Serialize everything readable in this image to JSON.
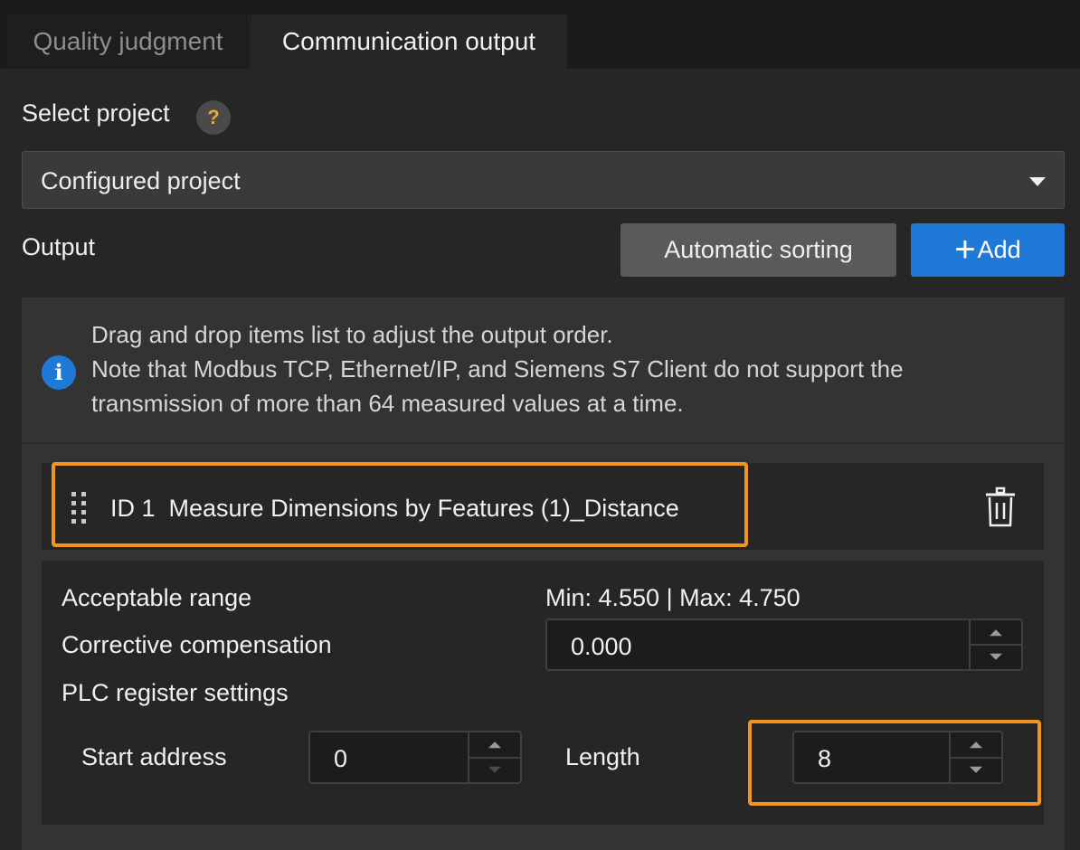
{
  "tabs": [
    {
      "label": "Quality judgment",
      "active": false
    },
    {
      "label": "Communication output",
      "active": true
    }
  ],
  "select_project": {
    "label": "Select project",
    "help_icon": "question-mark-icon",
    "selected": "Configured project"
  },
  "output": {
    "label": "Output",
    "sort_button": "Automatic sorting",
    "add_button": "Add",
    "add_icon": "plus-icon"
  },
  "info": {
    "icon": "info-icon",
    "lines": [
      "Drag and drop items list to adjust the output order.",
      "Note that Modbus TCP, Ethernet/IP, and Siemens S7 Client do not support the",
      "transmission of more than 64 measured values at a time."
    ]
  },
  "items": [
    {
      "title": "ID 1  Measure Dimensions by Features (1)_Distance",
      "drag_icon": "drag-handle-icon",
      "delete_icon": "trash-icon",
      "acceptable_range_label": "Acceptable range",
      "acceptable_range_value": "Min: 4.550 | Max: 4.750",
      "corrective_compensation_label": "Corrective compensation",
      "corrective_compensation_value": "0.000",
      "plc_label": "PLC register settings",
      "start_address_label": "Start address",
      "start_address_value": "0",
      "length_label": "Length",
      "length_value": "8"
    }
  ],
  "colors": {
    "accent_blue": "#1e7ad6",
    "highlight_orange": "#f0961e",
    "help_yellow": "#e3a93a"
  }
}
